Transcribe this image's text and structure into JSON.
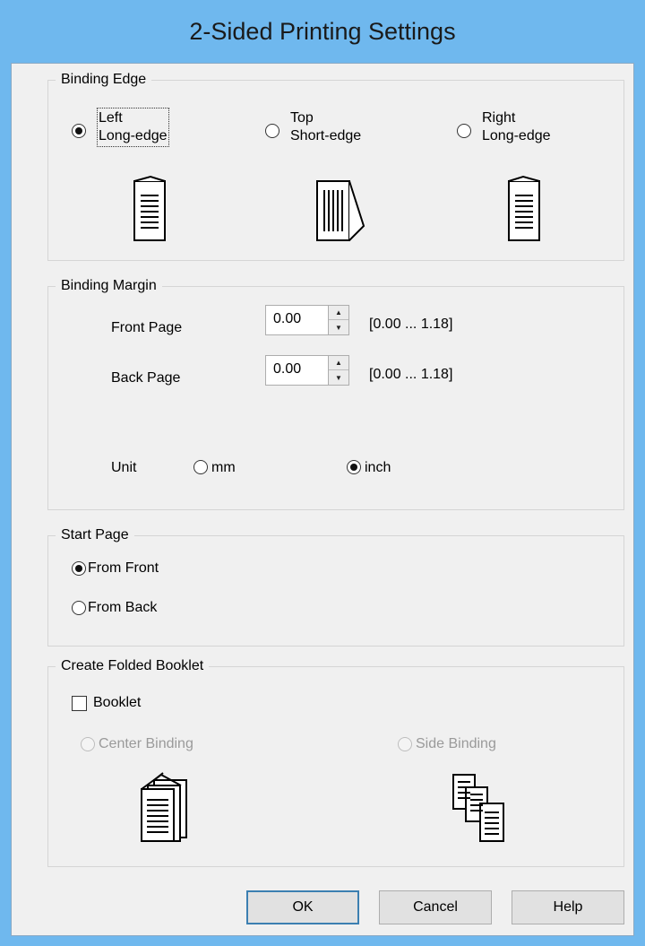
{
  "window": {
    "title": "2-Sided Printing Settings"
  },
  "binding_edge": {
    "title": "Binding Edge",
    "options": [
      {
        "line1": "Left",
        "line2": "Long-edge",
        "selected": true
      },
      {
        "line1": "Top",
        "line2": "Short-edge",
        "selected": false
      },
      {
        "line1": "Right",
        "line2": "Long-edge",
        "selected": false
      }
    ],
    "icons": [
      "left-binding-document-icon",
      "top-binding-document-icon",
      "right-binding-document-icon"
    ]
  },
  "binding_margin": {
    "title": "Binding Margin",
    "front_label": "Front Page",
    "front_value": "0.00",
    "front_range": "[0.00 ... 1.18]",
    "back_label": "Back Page",
    "back_value": "0.00",
    "back_range": "[0.00 ... 1.18]",
    "unit_label": "Unit",
    "unit_options": [
      {
        "label": "mm",
        "selected": false
      },
      {
        "label": "inch",
        "selected": true
      }
    ]
  },
  "start_page": {
    "title": "Start Page",
    "options": [
      {
        "label": "From Front",
        "selected": true
      },
      {
        "label": "From Back",
        "selected": false
      }
    ]
  },
  "booklet": {
    "title": "Create Folded Booklet",
    "checkbox_label": "Booklet",
    "checked": false,
    "options": [
      {
        "label": "Center Binding",
        "selected": false,
        "disabled": true
      },
      {
        "label": "Side Binding",
        "selected": false,
        "disabled": true
      }
    ],
    "icons": [
      "center-binding-booklet-icon",
      "side-binding-booklet-icon"
    ]
  },
  "buttons": {
    "ok": "OK",
    "cancel": "Cancel",
    "help": "Help"
  }
}
